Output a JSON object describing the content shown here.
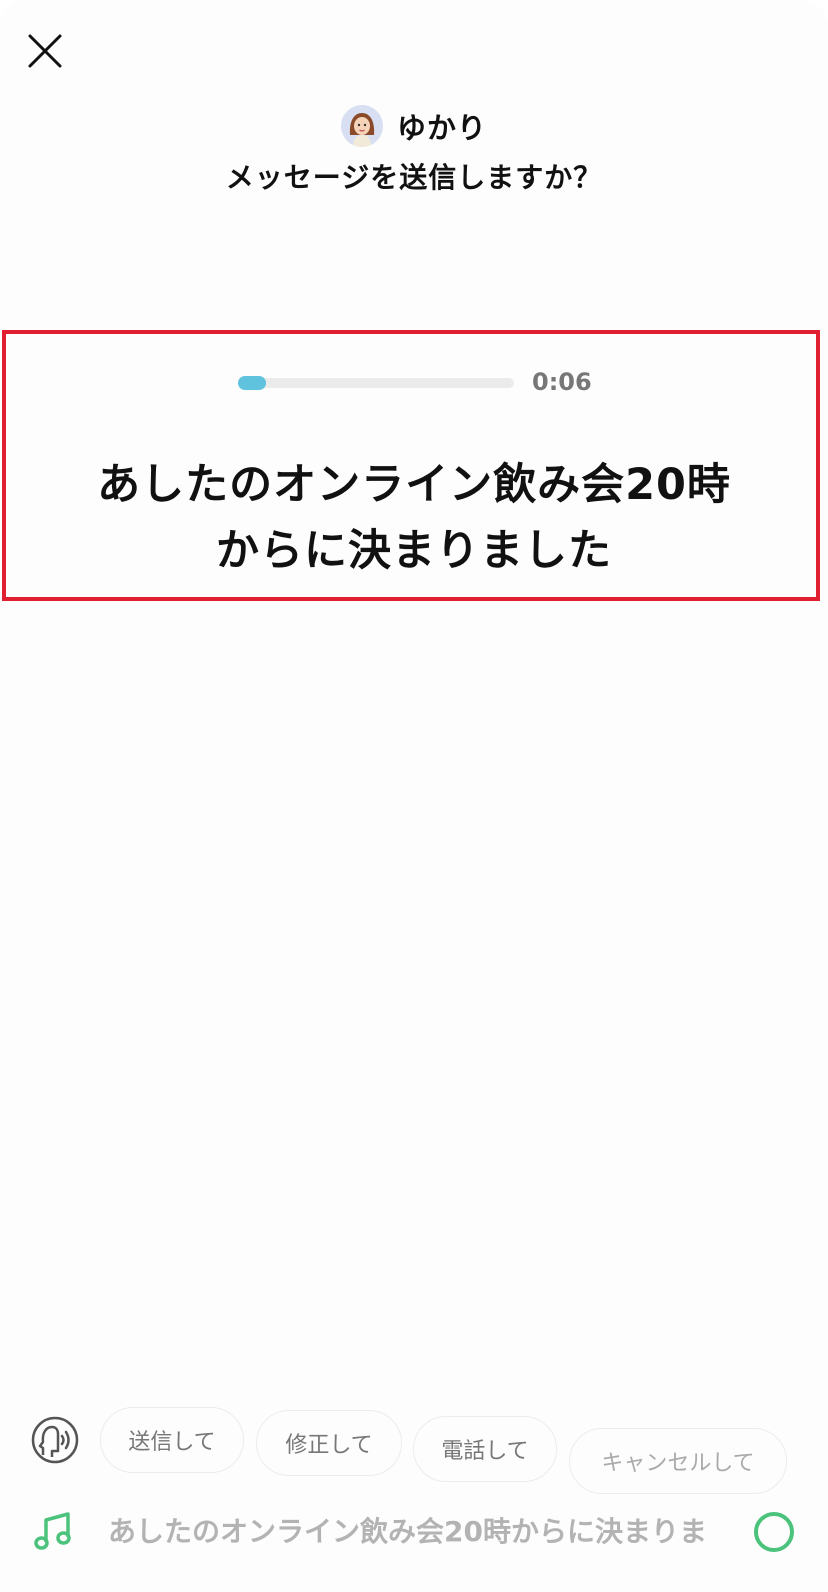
{
  "header": {
    "recipient_name": "ゆかり",
    "title": "メッセージを送信しますか？"
  },
  "player": {
    "time": "0:06",
    "progress_fraction": 0.04
  },
  "transcript": {
    "line1": "あしたのオンライン飲み会20時",
    "line2": "からに決まりました"
  },
  "suggestions": [
    "送信して",
    "修正して",
    "電話して",
    "キャンセルして"
  ],
  "input": {
    "text": "あしたのオンライン飲み会20時からに決まりま"
  },
  "colors": {
    "accent_green": "#4cc37c",
    "progress_blue": "#5fc3de",
    "highlight_red": "#e02030"
  },
  "icons": {
    "close": "close-icon",
    "voice_command": "voice-command-icon",
    "music": "music-note-icon",
    "mic": "mic-circle-icon"
  }
}
